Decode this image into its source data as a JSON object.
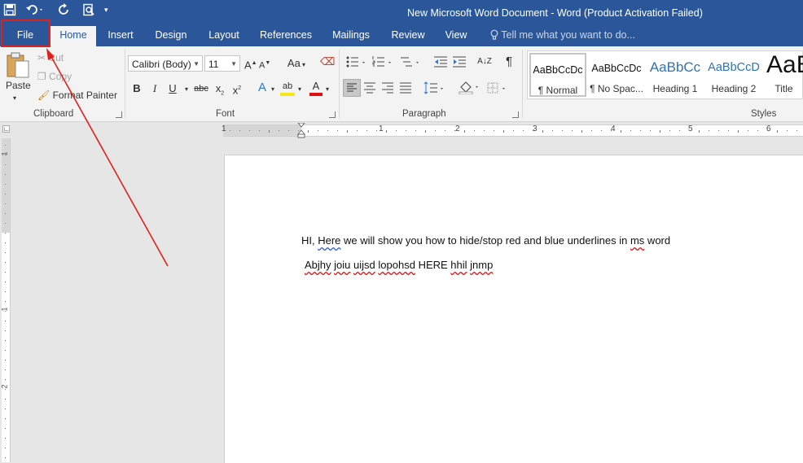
{
  "window": {
    "title": "New Microsoft Word Document - Word (Product Activation Failed)"
  },
  "quick_access": {
    "icons": [
      "save-icon",
      "undo-icon",
      "redo-icon",
      "print-preview-icon",
      "customize-dropdown-icon"
    ]
  },
  "tabs": {
    "file": "File",
    "home": "Home",
    "insert": "Insert",
    "design": "Design",
    "layout": "Layout",
    "references": "References",
    "mailings": "Mailings",
    "review": "Review",
    "view": "View",
    "tell_me": "Tell me what you want to do..."
  },
  "clipboard": {
    "paste": "Paste",
    "cut": "Cut",
    "copy": "Copy",
    "format_painter": "Format Painter",
    "label": "Clipboard"
  },
  "font": {
    "name": "Calibri (Body)",
    "size": "11",
    "grow": "A",
    "shrink": "A",
    "change_case": "Aa",
    "bold": "B",
    "italic": "I",
    "underline": "U",
    "strike": "abc",
    "subscript": "x",
    "superscript": "x",
    "effects": "A",
    "highlight": "ab",
    "color": "A",
    "label": "Font"
  },
  "paragraph": {
    "label": "Paragraph",
    "sort": "A↓Z",
    "pilcrow": "¶"
  },
  "styles": {
    "label": "Styles",
    "items": [
      {
        "preview": "AaBbCcDc",
        "name": "¶ Normal"
      },
      {
        "preview": "AaBbCcDc",
        "name": "¶ No Spac..."
      },
      {
        "preview": "AaBbCc",
        "name": "Heading 1"
      },
      {
        "preview": "AaBbCcD",
        "name": "Heading 2"
      },
      {
        "preview": "AaB",
        "name": "Title"
      }
    ]
  },
  "ruler": {
    "numbers": [
      "1",
      "1",
      "2",
      "3",
      "4",
      "5",
      "6"
    ],
    "v_numbers": [
      "1",
      "1",
      "2"
    ]
  },
  "document": {
    "line1_prefix": "HI, ",
    "line1_word": "Here",
    "line1_middle": " we will show you how to hide/stop red and blue underlines in ",
    "line1_ms": "ms",
    "line1_suffix": " word",
    "line2_w1": "Abjhy",
    "line2_w2": "joiu",
    "line2_w3": "uijsd",
    "line2_w4": "lopohsd",
    "line2_mid": " HERE ",
    "line2_w5": "hhil",
    "line2_w6": "jnmp"
  }
}
